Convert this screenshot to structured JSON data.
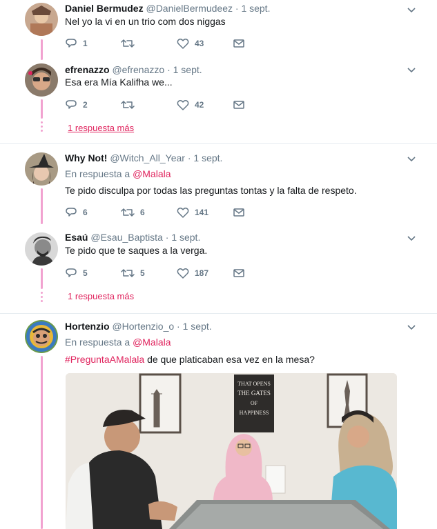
{
  "tweets": [
    {
      "name": "Daniel Bermudez",
      "handle": "@DanielBermudeez",
      "date": "1 sept.",
      "text": "Nel yo la vi en un trio com dos niggas",
      "replies": "1",
      "retweets": "",
      "likes": "43"
    },
    {
      "name": "efrenazzo",
      "handle": "@efrenazzo",
      "date": "1 sept.",
      "text": "Esa era Mía Kalifha we...",
      "replies": "2",
      "retweets": "",
      "likes": "42"
    },
    {
      "name": "Why Not!",
      "handle": "@Witch_All_Year",
      "date": "1 sept.",
      "reply_prefix": "En respuesta a",
      "reply_target": "@Malala",
      "text": "Te pido disculpa por todas las preguntas tontas y la falta de respeto.",
      "replies": "6",
      "retweets": "6",
      "likes": "141"
    },
    {
      "name": "Esaú",
      "handle": "@Esau_Baptista",
      "date": "1 sept.",
      "text": "Te pido que te saques a la verga.",
      "replies": "5",
      "retweets": "5",
      "likes": "187"
    },
    {
      "name": "Hortenzio",
      "handle": "@Hortenzio_o",
      "date": "1 sept.",
      "reply_prefix": "En respuesta a",
      "reply_target": "@Malala",
      "hashtag": "#PreguntaAMalala",
      "text": " de que platicaban esa vez en la mesa?",
      "media_sign": [
        "THAT OPENS",
        "THE GATES",
        "OF",
        "HAPPINESS"
      ]
    }
  ],
  "more_replies_1": "1 respuesta más",
  "more_replies_2": "1 respuesta más",
  "separator_dot": "·",
  "colors": {
    "accent": "#e0245e",
    "thread": "#f1a2d0",
    "muted": "#657786"
  },
  "icons": [
    "reply-icon",
    "retweet-icon",
    "like-icon",
    "message-icon",
    "chevron-down-icon"
  ]
}
